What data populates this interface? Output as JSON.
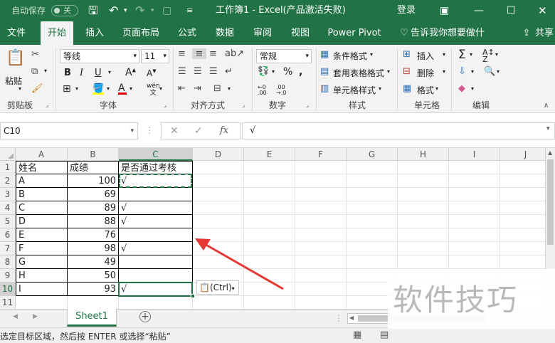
{
  "titlebar": {
    "autosave_label": "自动保存",
    "autosave_state": "关",
    "doc_title": "工作簿1 - Excel(产品激活失败)",
    "login": "登录"
  },
  "tabs": [
    "文件",
    "开始",
    "插入",
    "页面布局",
    "公式",
    "数据",
    "审阅",
    "视图",
    "Power Pivot"
  ],
  "tell_me": "告诉我你想要做什么",
  "share": "共享",
  "ribbon": {
    "paste": "粘贴",
    "clipboard": "剪贴板",
    "font_name": "等线",
    "font_size": "11",
    "font": "字体",
    "alignment": "对齐方式",
    "number_format": "常规",
    "number": "数字",
    "cond_format": "条件格式",
    "table_format": "套用表格格式",
    "cell_style": "单元格样式",
    "styles": "样式",
    "insert": "插入",
    "delete": "删除",
    "format": "格式",
    "cells": "单元格",
    "editing": "编辑",
    "wen": "wén"
  },
  "formula": {
    "name_box": "C10",
    "fx": "fx",
    "content": "√"
  },
  "columns": [
    "A",
    "B",
    "C",
    "D",
    "E",
    "F",
    "G",
    "H",
    "I",
    "J"
  ],
  "rows": [
    {
      "n": "1",
      "a": "姓名",
      "b": "成绩",
      "c": "是否通过考核"
    },
    {
      "n": "2",
      "a": "A",
      "b": "100",
      "c": "√"
    },
    {
      "n": "3",
      "a": "B",
      "b": "69",
      "c": ""
    },
    {
      "n": "4",
      "a": "C",
      "b": "89",
      "c": "√"
    },
    {
      "n": "5",
      "a": "D",
      "b": "88",
      "c": "√"
    },
    {
      "n": "6",
      "a": "E",
      "b": "76",
      "c": ""
    },
    {
      "n": "7",
      "a": "F",
      "b": "98",
      "c": "√"
    },
    {
      "n": "8",
      "a": "G",
      "b": "49",
      "c": ""
    },
    {
      "n": "9",
      "a": "H",
      "b": "50",
      "c": ""
    },
    {
      "n": "10",
      "a": "I",
      "b": "93",
      "c": "√"
    },
    {
      "n": "11",
      "a": "",
      "b": "",
      "c": ""
    }
  ],
  "paste_options": "(Ctrl)",
  "sheet_tab": "Sheet1",
  "status_text": "选定目标区域，然后按 ENTER 或选择“粘贴”",
  "watermark": "软件技巧",
  "colors": {
    "excel_green": "#217346",
    "arrow_red": "#e53935",
    "selection_green": "#217346"
  }
}
